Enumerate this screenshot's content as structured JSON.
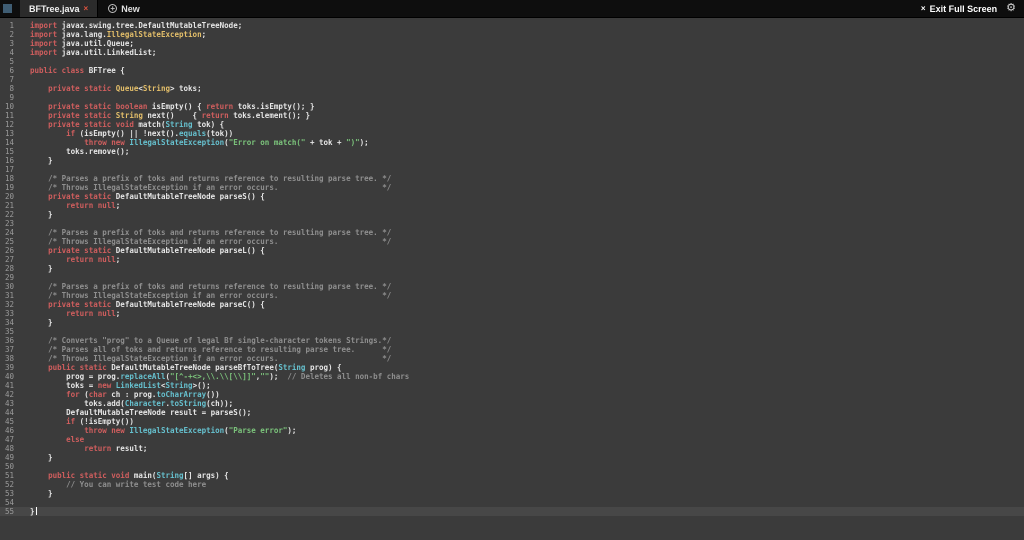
{
  "topbar": {
    "tab": {
      "label": "BFTree.java",
      "close_icon": "×"
    },
    "new_button": {
      "label": "New",
      "icon": "+"
    },
    "exit_full_screen": {
      "label": "Exit Full Screen",
      "icon": "×"
    },
    "settings_icon": "⚙"
  },
  "colors": {
    "topbar_bg": "#0e0e0e",
    "editor_bg": "#3b3b3b",
    "text": "#e6e6e6",
    "keyword": "#d05e5e",
    "type": "#e4bf6a",
    "support": "#66c1cf",
    "string": "#7cc57c",
    "comment": "#8f8f8f",
    "tab_close": "#e0543f"
  },
  "editor": {
    "cursor_line": 55,
    "lines": [
      [
        [
          "k",
          "import "
        ],
        [
          "p",
          "javax.swing.tree.DefaultMutableTreeNode;"
        ]
      ],
      [
        [
          "k",
          "import "
        ],
        [
          "p",
          "java.lang."
        ],
        [
          "t",
          "IllegalStateException"
        ],
        [
          "p",
          ";"
        ]
      ],
      [
        [
          "k",
          "import "
        ],
        [
          "p",
          "java.util.Queue;"
        ]
      ],
      [
        [
          "k",
          "import "
        ],
        [
          "p",
          "java.util.LinkedList;"
        ]
      ],
      [],
      [
        [
          "k",
          "public class "
        ],
        [
          "p",
          "BFTree {"
        ]
      ],
      [],
      [
        [
          "p",
          "    "
        ],
        [
          "k",
          "private static "
        ],
        [
          "t",
          "Queue"
        ],
        [
          "p",
          "<"
        ],
        [
          "t",
          "String"
        ],
        [
          "p",
          "> toks;"
        ]
      ],
      [],
      [
        [
          "p",
          "    "
        ],
        [
          "k",
          "private static boolean "
        ],
        [
          "p",
          "isEmpty() { "
        ],
        [
          "k",
          "return "
        ],
        [
          "p",
          "toks.isEmpty(); }"
        ]
      ],
      [
        [
          "p",
          "    "
        ],
        [
          "k",
          "private static "
        ],
        [
          "t",
          "String "
        ],
        [
          "p",
          "next()    { "
        ],
        [
          "k",
          "return "
        ],
        [
          "p",
          "toks.element(); }"
        ]
      ],
      [
        [
          "p",
          "    "
        ],
        [
          "k",
          "private static void "
        ],
        [
          "p",
          "match("
        ],
        [
          "c",
          "String"
        ],
        [
          "p",
          " tok) {"
        ]
      ],
      [
        [
          "p",
          "        "
        ],
        [
          "k",
          "if "
        ],
        [
          "p",
          "(isEmpty() || !next()."
        ],
        [
          "c",
          "equals"
        ],
        [
          "p",
          "(tok))"
        ]
      ],
      [
        [
          "p",
          "            "
        ],
        [
          "k",
          "throw new "
        ],
        [
          "c",
          "IllegalStateException"
        ],
        [
          "p",
          "("
        ],
        [
          "s",
          "\"Error on match(\""
        ],
        [
          "p",
          " + tok + "
        ],
        [
          "s",
          "\")\""
        ],
        [
          "p",
          ");"
        ]
      ],
      [
        [
          "p",
          "        toks.remove();"
        ]
      ],
      [
        [
          "p",
          "    }"
        ]
      ],
      [],
      [
        [
          "p",
          "    "
        ],
        [
          "m",
          "/* Parses a prefix of toks and returns reference to resulting parse tree. */"
        ]
      ],
      [
        [
          "p",
          "    "
        ],
        [
          "m",
          "/* Throws IllegalStateException if an error occurs.                       */"
        ]
      ],
      [
        [
          "p",
          "    "
        ],
        [
          "k",
          "private static "
        ],
        [
          "p",
          "DefaultMutableTreeNode parseS() {"
        ]
      ],
      [
        [
          "p",
          "        "
        ],
        [
          "k",
          "return null"
        ],
        [
          "p",
          ";"
        ]
      ],
      [
        [
          "p",
          "    }"
        ]
      ],
      [],
      [
        [
          "p",
          "    "
        ],
        [
          "m",
          "/* Parses a prefix of toks and returns reference to resulting parse tree. */"
        ]
      ],
      [
        [
          "p",
          "    "
        ],
        [
          "m",
          "/* Throws IllegalStateException if an error occurs.                       */"
        ]
      ],
      [
        [
          "p",
          "    "
        ],
        [
          "k",
          "private static "
        ],
        [
          "p",
          "DefaultMutableTreeNode parseL() {"
        ]
      ],
      [
        [
          "p",
          "        "
        ],
        [
          "k",
          "return null"
        ],
        [
          "p",
          ";"
        ]
      ],
      [
        [
          "p",
          "    }"
        ]
      ],
      [],
      [
        [
          "p",
          "    "
        ],
        [
          "m",
          "/* Parses a prefix of toks and returns reference to resulting parse tree. */"
        ]
      ],
      [
        [
          "p",
          "    "
        ],
        [
          "m",
          "/* Throws IllegalStateException if an error occurs.                       */"
        ]
      ],
      [
        [
          "p",
          "    "
        ],
        [
          "k",
          "private static "
        ],
        [
          "p",
          "DefaultMutableTreeNode parseC() {"
        ]
      ],
      [
        [
          "p",
          "        "
        ],
        [
          "k",
          "return null"
        ],
        [
          "p",
          ";"
        ]
      ],
      [
        [
          "p",
          "    }"
        ]
      ],
      [],
      [
        [
          "p",
          "    "
        ],
        [
          "m",
          "/* Converts \"prog\" to a Queue of legal Bf single-character tokens Strings.*/"
        ]
      ],
      [
        [
          "p",
          "    "
        ],
        [
          "m",
          "/* Parses all of toks and returns reference to resulting parse tree.      */"
        ]
      ],
      [
        [
          "p",
          "    "
        ],
        [
          "m",
          "/* Throws IllegalStateException if an error occurs.                       */"
        ]
      ],
      [
        [
          "p",
          "    "
        ],
        [
          "k",
          "public static "
        ],
        [
          "p",
          "DefaultMutableTreeNode parseBfToTree("
        ],
        [
          "c",
          "String"
        ],
        [
          "p",
          " prog) {"
        ]
      ],
      [
        [
          "p",
          "        prog = prog."
        ],
        [
          "c",
          "replaceAll"
        ],
        [
          "p",
          "("
        ],
        [
          "s",
          "\"[^-+<>,\\\\.\\\\[\\\\]]\""
        ],
        [
          "p",
          ","
        ],
        [
          "s",
          "\"\""
        ],
        [
          "p",
          ");  "
        ],
        [
          "m",
          "// Deletes all non-bf chars"
        ]
      ],
      [
        [
          "p",
          "        toks = "
        ],
        [
          "k",
          "new "
        ],
        [
          "c",
          "LinkedList"
        ],
        [
          "p",
          "<"
        ],
        [
          "c",
          "String"
        ],
        [
          "p",
          ">();"
        ]
      ],
      [
        [
          "p",
          "        "
        ],
        [
          "k",
          "for "
        ],
        [
          "p",
          "("
        ],
        [
          "k",
          "char"
        ],
        [
          "p",
          " ch : prog."
        ],
        [
          "c",
          "toCharArray"
        ],
        [
          "p",
          "())"
        ]
      ],
      [
        [
          "p",
          "            toks.add("
        ],
        [
          "c",
          "Character"
        ],
        [
          "p",
          "."
        ],
        [
          "c",
          "toString"
        ],
        [
          "p",
          "(ch));"
        ]
      ],
      [
        [
          "p",
          "        DefaultMutableTreeNode result = parseS();"
        ]
      ],
      [
        [
          "p",
          "        "
        ],
        [
          "k",
          "if "
        ],
        [
          "p",
          "(!isEmpty())"
        ]
      ],
      [
        [
          "p",
          "            "
        ],
        [
          "k",
          "throw new "
        ],
        [
          "c",
          "IllegalStateException"
        ],
        [
          "p",
          "("
        ],
        [
          "s",
          "\"Parse error\""
        ],
        [
          "p",
          ");"
        ]
      ],
      [
        [
          "p",
          "        "
        ],
        [
          "k",
          "else"
        ]
      ],
      [
        [
          "p",
          "            "
        ],
        [
          "k",
          "return "
        ],
        [
          "p",
          "result;"
        ]
      ],
      [
        [
          "p",
          "    }"
        ]
      ],
      [],
      [
        [
          "p",
          "    "
        ],
        [
          "k",
          "public static void "
        ],
        [
          "p",
          "main("
        ],
        [
          "c",
          "String"
        ],
        [
          "p",
          "[] args) {"
        ]
      ],
      [
        [
          "p",
          "        "
        ],
        [
          "m",
          "// You can write test code here"
        ]
      ],
      [
        [
          "p",
          "    }"
        ]
      ],
      [],
      [
        [
          "p",
          "}"
        ]
      ]
    ]
  }
}
